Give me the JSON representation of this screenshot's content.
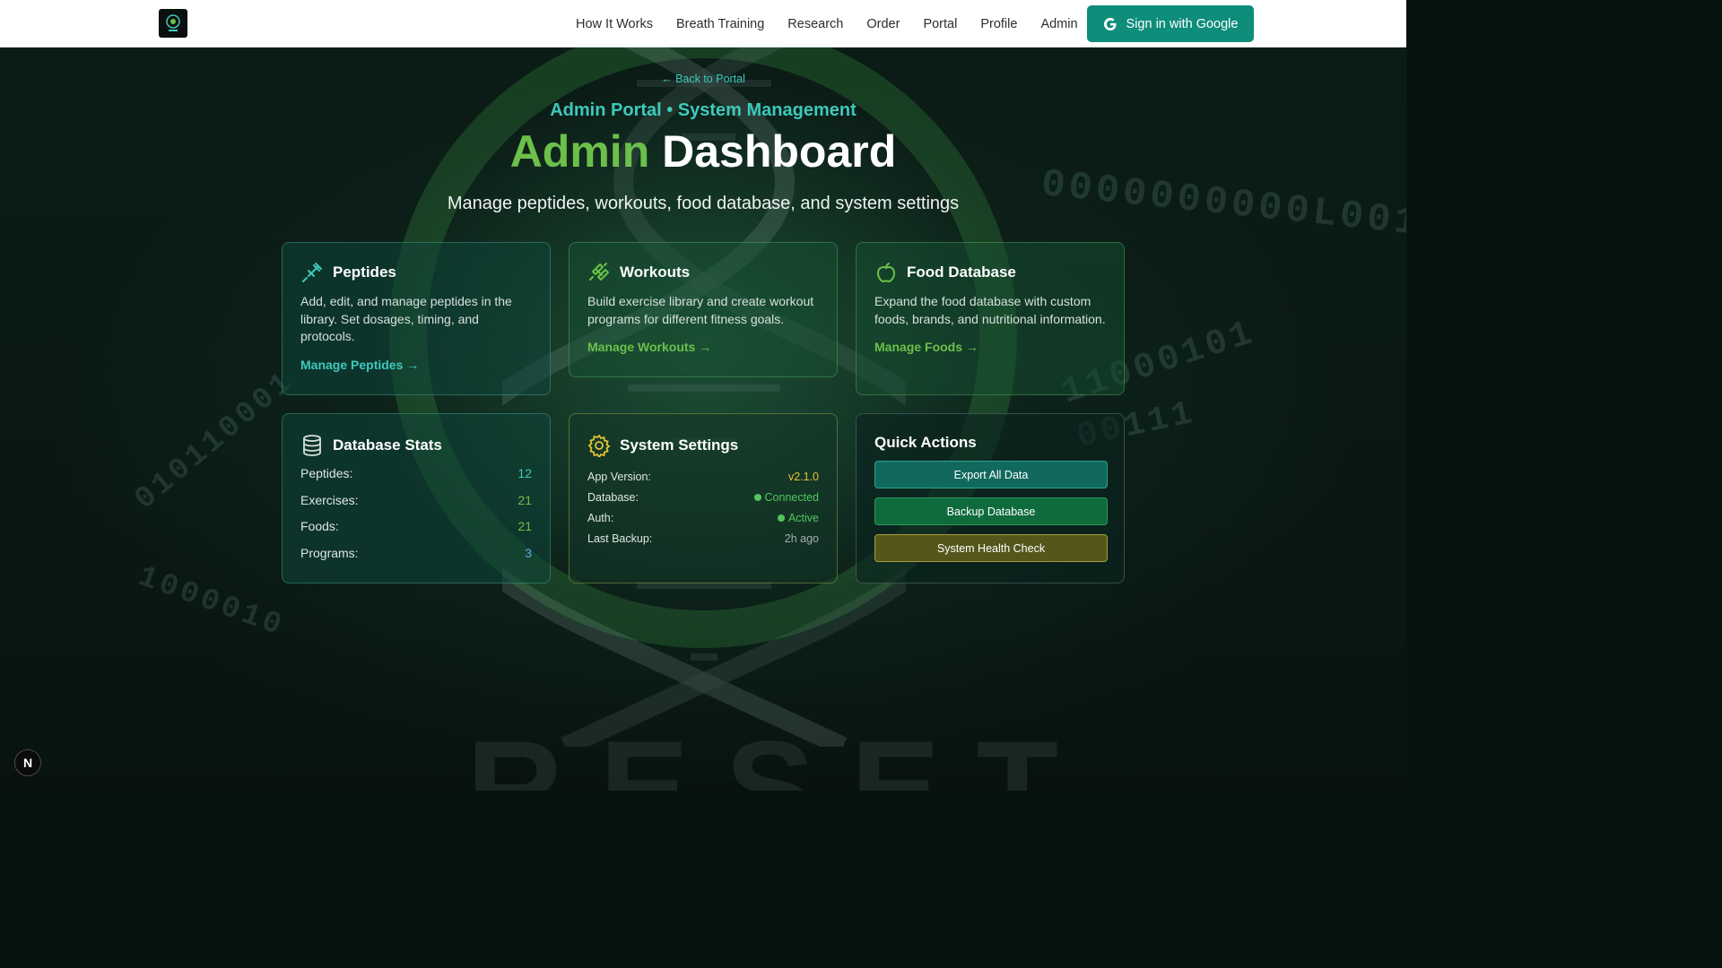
{
  "nav": {
    "links": [
      "How It Works",
      "Breath Training",
      "Research",
      "Order",
      "Portal",
      "Profile",
      "Admin"
    ],
    "signin_label": "Sign in with Google",
    "signin_color": "#0f8d7b"
  },
  "header": {
    "back_link": "← Back to Portal",
    "eyebrow": "Admin Portal • System Management",
    "title_accent": "Admin",
    "title_rest": " Dashboard",
    "subtitle": "Manage peptides, workouts, food database, and system settings"
  },
  "cards": {
    "peptides": {
      "title": "Peptides",
      "desc": "Add, edit, and manage peptides in the library. Set dosages, timing, and protocols.",
      "link": "Manage Peptides →",
      "icon": "syringe-icon",
      "accent": "#3ec9bb"
    },
    "workouts": {
      "title": "Workouts",
      "desc": "Build exercise library and create workout programs for different fitness goals.",
      "link": "Manage Workouts →",
      "icon": "dumbbell-icon",
      "accent": "#6cc04a"
    },
    "foods": {
      "title": "Food Database",
      "desc": "Expand the food database with custom foods, brands, and nutritional information.",
      "link": "Manage Foods →",
      "icon": "apple-icon",
      "accent": "#6cc04a"
    }
  },
  "stats": {
    "title": "Database Stats",
    "icon": "database-icon",
    "rows": [
      {
        "label": "Peptides:",
        "value": "12"
      },
      {
        "label": "Exercises:",
        "value": "21"
      },
      {
        "label": "Foods:",
        "value": "21"
      },
      {
        "label": "Programs:",
        "value": "3"
      }
    ]
  },
  "settings": {
    "title": "System Settings",
    "icon": "gear-icon",
    "rows": [
      {
        "label": "App Version:",
        "value": "v2.1.0"
      },
      {
        "label": "Database:",
        "value": "Connected"
      },
      {
        "label": "Auth:",
        "value": "Active"
      },
      {
        "label": "Last Backup:",
        "value": "2h ago"
      }
    ]
  },
  "quick_actions": {
    "title": "Quick Actions",
    "buttons": [
      "Export All Data",
      "Backup Database",
      "System Health Check"
    ]
  },
  "badge": "N"
}
